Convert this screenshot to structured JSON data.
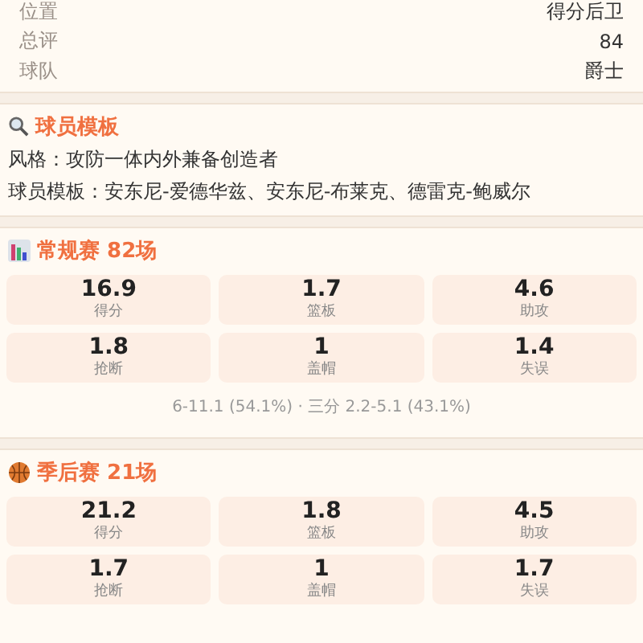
{
  "info_rows": [
    {
      "label": "位置",
      "value": "得分后卫"
    },
    {
      "label": "总评",
      "value": "84"
    },
    {
      "label": "球队",
      "value": "爵士"
    }
  ],
  "template": {
    "title": "球员模板",
    "lines": [
      "风格：攻防一体内外兼备创造者",
      "球员模板：安东尼-爱德华兹、安东尼-布莱克、德雷克-鲍威尔"
    ]
  },
  "stat_sections": [
    {
      "kind": "regular",
      "title": "常规赛 82场",
      "stats": [
        {
          "value": "16.9",
          "label": "得分"
        },
        {
          "value": "1.7",
          "label": "篮板"
        },
        {
          "value": "4.6",
          "label": "助攻"
        },
        {
          "value": "1.8",
          "label": "抢断"
        },
        {
          "value": "1",
          "label": "盖帽"
        },
        {
          "value": "1.4",
          "label": "失误"
        }
      ],
      "footer": "6-11.1 (54.1%) · 三分 2.2-5.1 (43.1%)"
    },
    {
      "kind": "playoffs",
      "title": "季后赛 21场",
      "stats": [
        {
          "value": "21.2",
          "label": "得分"
        },
        {
          "value": "1.8",
          "label": "篮板"
        },
        {
          "value": "4.5",
          "label": "助攻"
        },
        {
          "value": "1.7",
          "label": "抢断"
        },
        {
          "value": "1",
          "label": "盖帽"
        },
        {
          "value": "1.7",
          "label": "失误"
        }
      ]
    }
  ]
}
